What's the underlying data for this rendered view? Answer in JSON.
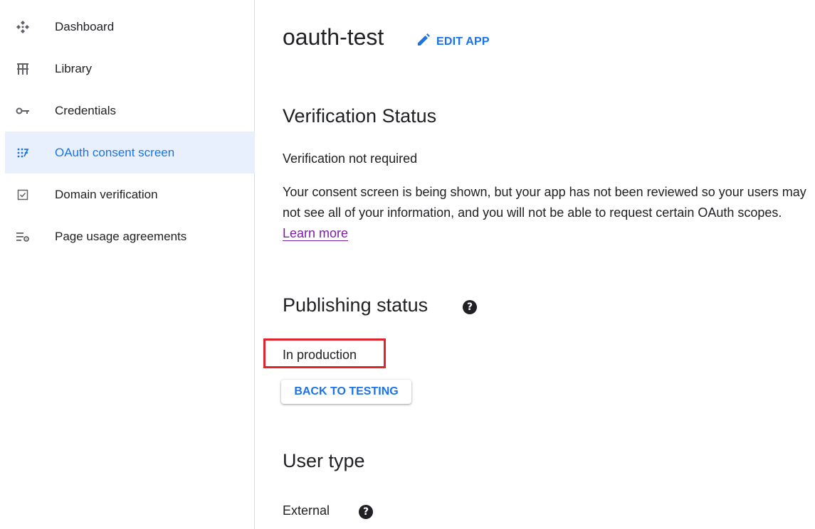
{
  "sidebar": {
    "items": [
      {
        "label": "Dashboard",
        "icon": "dashboard-icon",
        "active": false
      },
      {
        "label": "Library",
        "icon": "library-icon",
        "active": false
      },
      {
        "label": "Credentials",
        "icon": "key-icon",
        "active": false
      },
      {
        "label": "OAuth consent screen",
        "icon": "consent-screen-icon",
        "active": true
      },
      {
        "label": "Domain verification",
        "icon": "checkbox-icon",
        "active": false
      },
      {
        "label": "Page usage agreements",
        "icon": "settings-list-icon",
        "active": false
      }
    ]
  },
  "main": {
    "app_name": "oauth-test",
    "edit_app_label": "EDIT APP",
    "verification": {
      "heading": "Verification Status",
      "status": "Verification not required",
      "description": "Your consent screen is being shown, but your app has not been reviewed so your users may not see all of your information, and you will not be able to request certain OAuth scopes.",
      "learn_more": "Learn more"
    },
    "publishing": {
      "heading": "Publishing status",
      "status": "In production",
      "back_button": "BACK TO TESTING"
    },
    "user_type": {
      "heading": "User type",
      "value": "External"
    }
  },
  "colors": {
    "accent": "#1a73e8",
    "active_bg": "#e8f0fe",
    "link": "#7b1fa2",
    "highlight_box": "#e0242c"
  }
}
